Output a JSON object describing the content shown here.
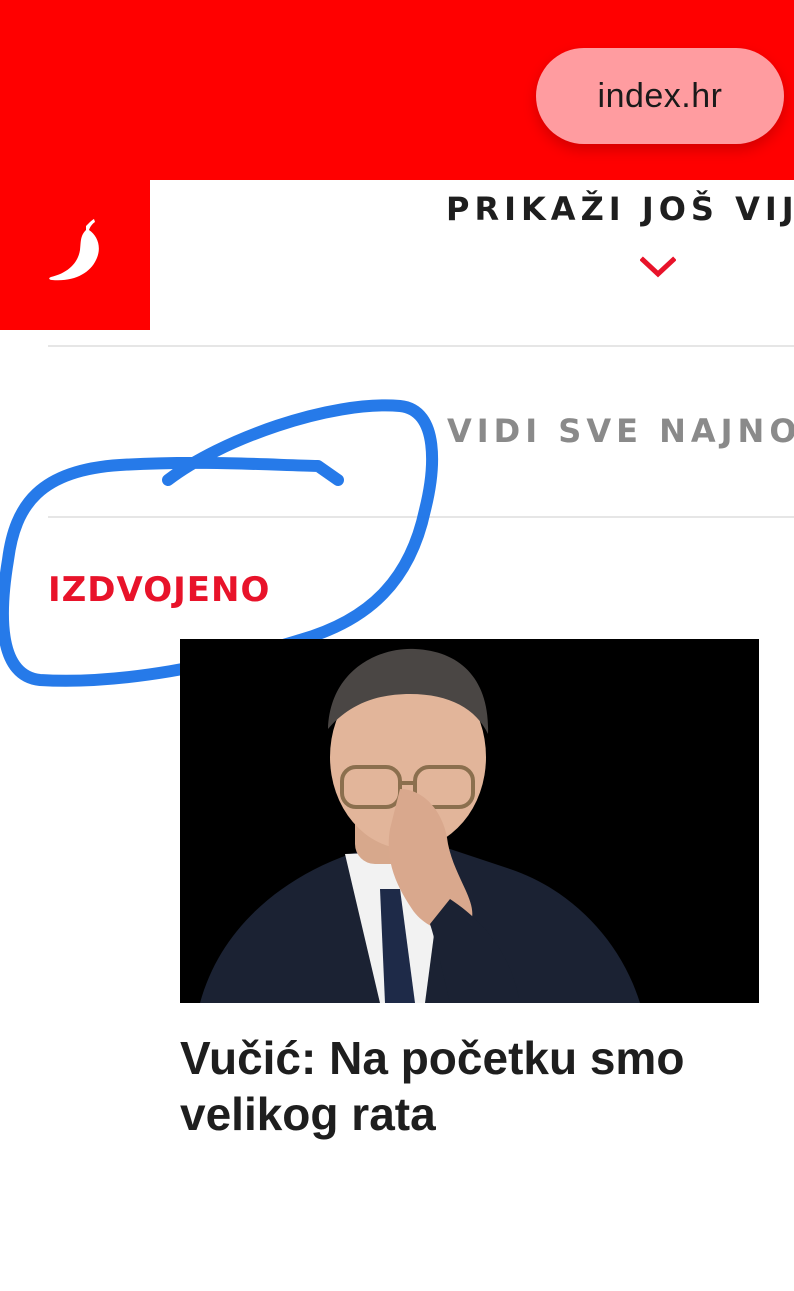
{
  "browser": {
    "url": "index.hr"
  },
  "header": {
    "logo_icon": "chili-pepper-icon",
    "show_more_label": "PRIKAŽI JOŠ VIJE",
    "show_more_icon": "chevron-down-icon"
  },
  "links": {
    "see_all_label": "VIDI SVE NAJNOV"
  },
  "featured": {
    "section_title": "IZDVOJENO",
    "article": {
      "headline": "Vučić: Na početku smo velikog rata",
      "image_description_icon": "article-photo"
    }
  },
  "annotation": {
    "scribble_color": "#1a73e8"
  },
  "colors": {
    "brand_red": "#ff0000",
    "section_red": "#e8132a",
    "pill": "#ff9ca0"
  }
}
